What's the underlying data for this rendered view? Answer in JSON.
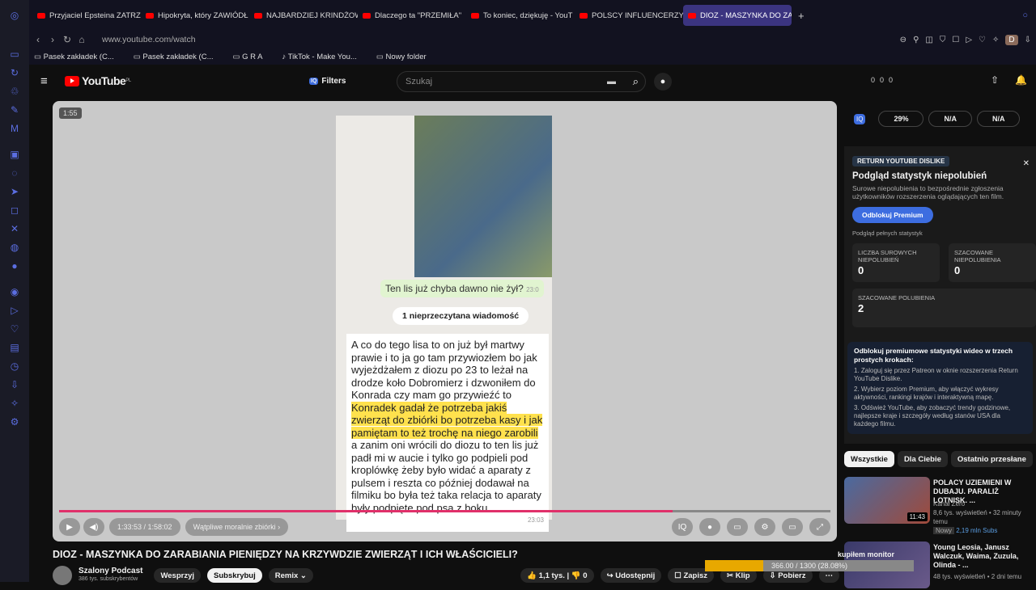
{
  "browser": {
    "tabs": [
      "Przyjaciel Epsteina ZATRZ",
      "Hipokryta, który ZAWIÓDŁ",
      "NAJBARDZIEJ KRINDŻOWE",
      "Dlaczego ta \"PRZEMIŁA\"",
      "To koniec, dziękuję - YouT",
      "POLSCY INFLUENCERZY",
      "DIOZ - MASZYNKA DO ZA"
    ],
    "url": "www.youtube.com/watch",
    "bookmarks": [
      "Pasek zakładek (C...",
      "Pasek zakładek (C...",
      "G R A",
      "TikTok - Make You...",
      "Nowy folder"
    ],
    "profile_initial": "D"
  },
  "youtube": {
    "logo": "YouTube",
    "region": "PL",
    "filters": "Filters",
    "search_placeholder": "Szukaj",
    "header_counts": [
      "0",
      "0",
      "0"
    ]
  },
  "video": {
    "badge_time": "1:55",
    "chat_bubble": "Ten lis już chyba dawno nie żył?",
    "bubble_time": "23:0",
    "unread": "1 nieprzeczytana wiadomość",
    "msg_a": "A co do tego lisa to on już był martwy prawie i to ja go tam przywiozłem bo jak wyjeżdżałem z diozu po 23 to leżał na drodze koło Dobromierz i dzwoniłem do Konrada czy mam go przywieźć to ",
    "msg_hl": "Konradek  gadał że potrzeba jakiś zwierząt do zbiórki bo potrzeba kasy i jak pamiętam to też trochę na niego zarobili",
    "msg_b": " a zanim oni wrócili do diozu to ten lis już padł mi w aucie i tylko go podpieli pod kroplówkę żeby było widać a aparaty z pulsem i reszta co później dodawał na filmiku bo była też taka relacja to aparaty były podpięte pod psa z boku",
    "msg_time": "23:03",
    "time": "1:33:53 / 1:58:02",
    "chapter": "Wątpliwe moralnie zbiórki",
    "progress": 0.795
  },
  "panel": {
    "stats": [
      "29%",
      "N/A",
      "N/A"
    ],
    "tag": "RETURN YOUTUBE DISLIKE",
    "heading": "Podgląd statystyk niepolubień",
    "desc": "Surowe niepolubienia to bezpośrednie zgłoszenia użytkowników rozszerzenia oglądających ten film.",
    "premium_btn": "Odblokuj Premium",
    "preview": "Podgląd pełnych statystyk",
    "c1_l": "LICZBA SUROWYCH NIEPOLUBIEŃ",
    "c1_v": "0",
    "c2_l": "SZACOWANE NIEPOLUBIENIA",
    "c2_v": "0",
    "c3_l": "SZACOWANE POLUBIENIA",
    "c3_v": "2",
    "info_t": "Odblokuj premiumowe statystyki wideo w trzech prostych krokach:",
    "steps": [
      "1. Zaloguj się przez Patreon w oknie rozszerzenia Return YouTube Dislike.",
      "2. Wybierz poziom Premium, aby włączyć wykresy aktywności, rankingi krajów i interaktywną mapę.",
      "3. Odśwież YouTube, aby zobaczyć trendy godzinowe, najlepsze kraje i szczegóły według stanów USA dla każdego filmu."
    ]
  },
  "chips": [
    "Wszystkie",
    "Dla Ciebie",
    "Ostatnio przesłane"
  ],
  "recs": [
    {
      "title": "POLACY UZIEMIENI W DUBAJU. PARALIŻ LOTNISK. ...",
      "channel": "Kanał Zero",
      "meta": "8,6 tys. wyświetleń • 32 minuty temu",
      "badge": "Nowy",
      "dur": "11:43",
      "sub": "2,19 mln Subs"
    },
    {
      "title": "Young Leosia, Janusz Walczuk, Waima, Zuzula, Olinda - ...",
      "channel": "",
      "meta": "48 tys. wyświetleń • 2 dni temu",
      "badge": "",
      "dur": "",
      "sub": ""
    }
  ],
  "title": "DIOZ - MASZYNKA DO ZARABIANIA PIENIĘDZY NA KRZYWDZIE ZWIERZĄT I ICH WŁAŚCICIELI?",
  "channel": {
    "name": "Szalony Podcast",
    "subs": "386 tys. subskrybentów",
    "support": "Wesprzyj",
    "subscribe": "Subskrybuj",
    "remix": "Remix"
  },
  "actions": {
    "likes": "1,1 tys.",
    "dislikes": "0",
    "share": "Udostępnij",
    "save": "Zapisz",
    "clip": "Klip",
    "download": "Pobierz"
  },
  "download": {
    "label": "kupiłem monitor",
    "stat": "366.00 / 1300 (28.08%)",
    "progress": 0.2808
  }
}
